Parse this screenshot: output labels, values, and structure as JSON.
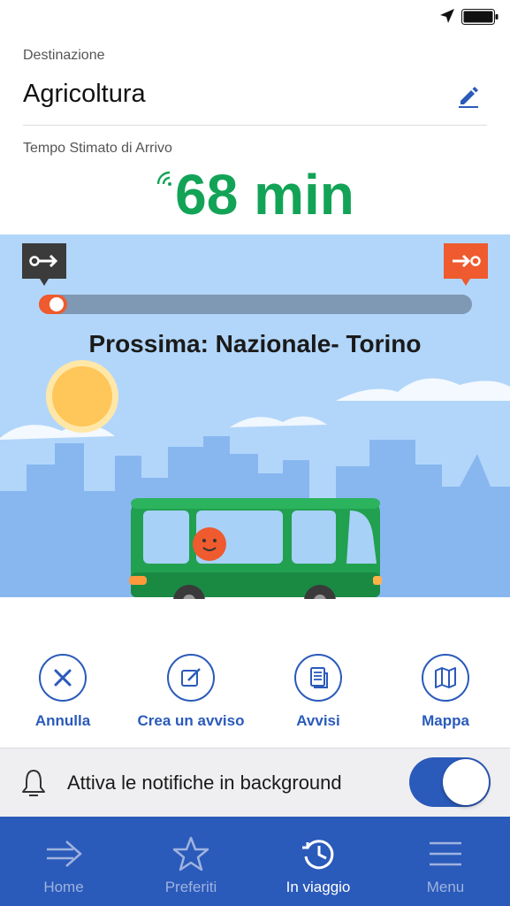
{
  "status": {
    "icons": [
      "location-arrow-icon",
      "battery-icon"
    ]
  },
  "destination": {
    "caption": "Destinazione",
    "value": "Agricoltura",
    "edit_icon": "pencil-icon"
  },
  "eta": {
    "caption": "Tempo Stimato di Arrivo",
    "value": "68 min",
    "live_icon": "signal-icon",
    "color": "#13a357"
  },
  "journey": {
    "next_stop_label": "Prossima: Nazionale- Torino",
    "progress": 0.06,
    "start_icon": "start-stop-icon",
    "end_icon": "end-stop-icon",
    "accent": "#ef5a2e"
  },
  "actions": [
    {
      "label": "Annulla",
      "icon": "close-icon"
    },
    {
      "label": "Crea un avviso",
      "icon": "edit-note-icon"
    },
    {
      "label": "Avvisi",
      "icon": "document-icon"
    },
    {
      "label": "Mappa",
      "icon": "map-icon"
    }
  ],
  "notifications": {
    "label": "Attiva le notifiche in background",
    "enabled": true
  },
  "tabs": [
    {
      "label": "Home",
      "icon": "arrow-right-icon",
      "active": false
    },
    {
      "label": "Preferiti",
      "icon": "star-icon",
      "active": false
    },
    {
      "label": "In viaggio",
      "icon": "clock-return-icon",
      "active": true
    },
    {
      "label": "Menu",
      "icon": "hamburger-icon",
      "active": false
    }
  ],
  "colors": {
    "primary": "#2a5aba",
    "sky": "#b2d6fa",
    "bus": "#21a050"
  }
}
